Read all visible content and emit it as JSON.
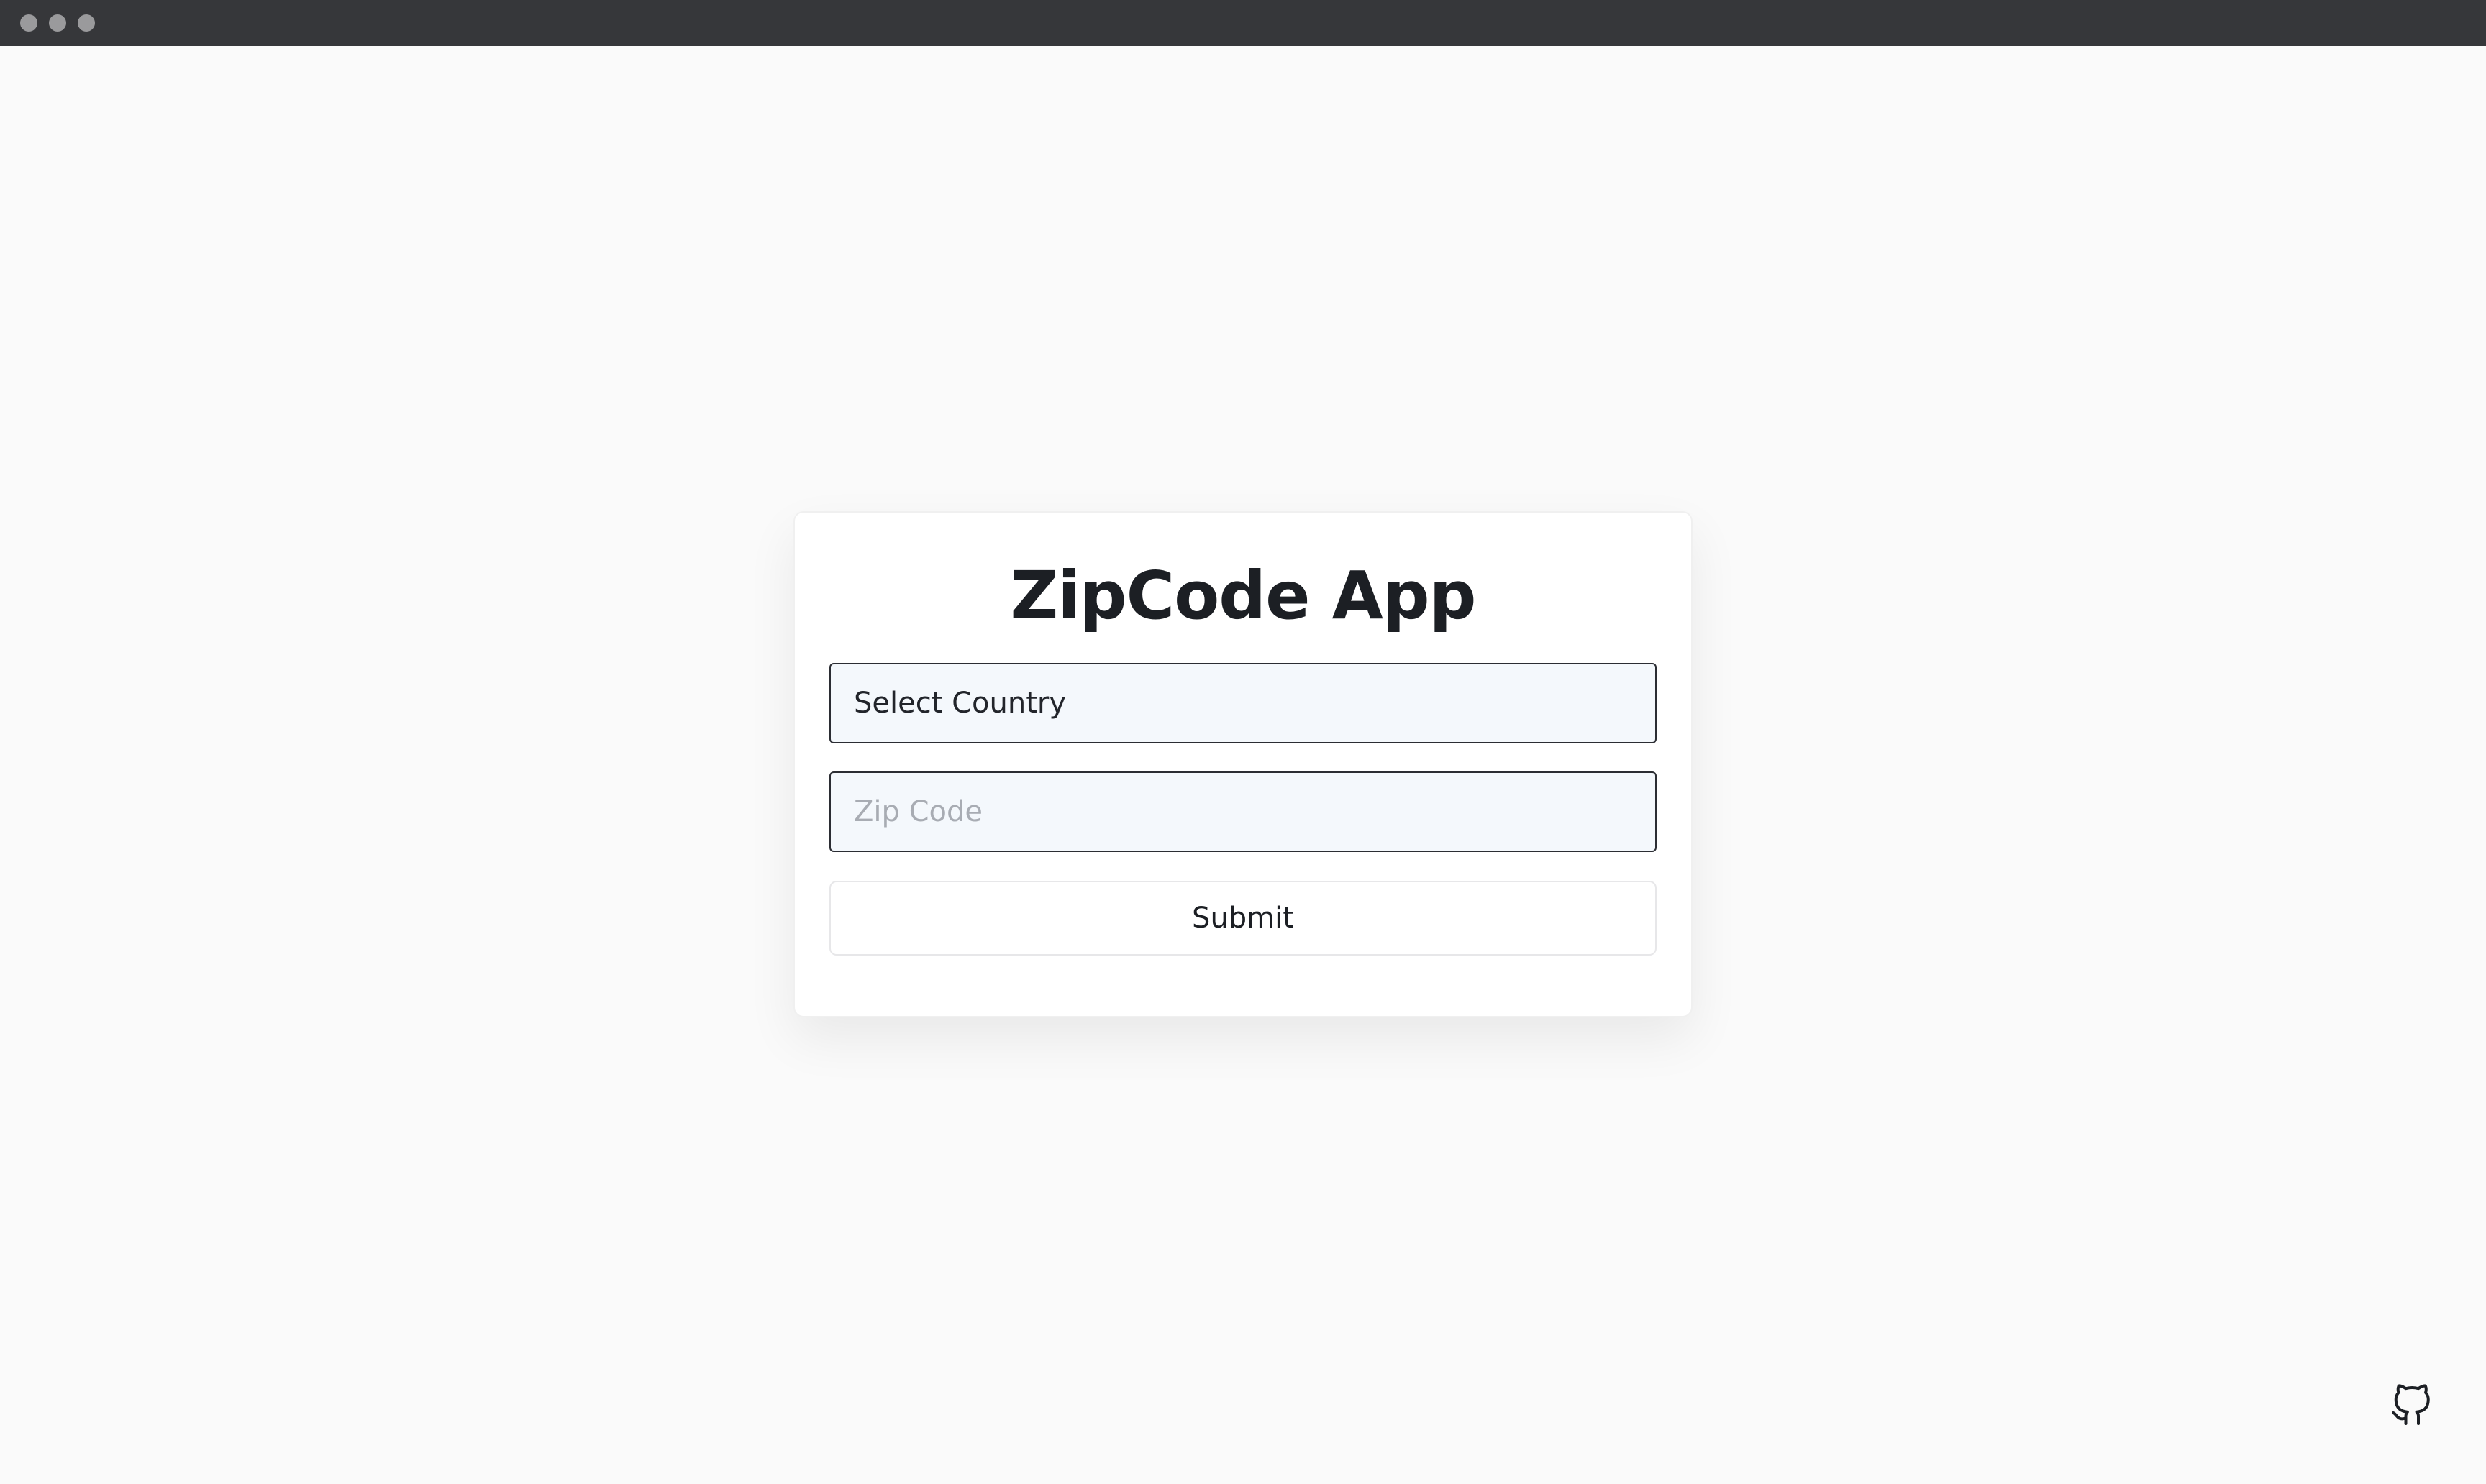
{
  "window": {
    "controls": [
      "close-dot",
      "minimize-dot",
      "maximize-dot"
    ]
  },
  "app": {
    "title": "ZipCode App"
  },
  "form": {
    "country_select": {
      "value": "Select Country"
    },
    "zip_input": {
      "value": "",
      "placeholder": "Zip Code"
    },
    "submit_label": "Submit"
  },
  "footer": {
    "icon": "github-icon"
  },
  "colors": {
    "background": "#fafafa",
    "titlebar": "#36373a",
    "card": "#ffffff",
    "input_background": "#f4f8fc",
    "input_border": "#2b2d33",
    "title_text": "#1c1f24",
    "placeholder": "#a8acb3"
  }
}
